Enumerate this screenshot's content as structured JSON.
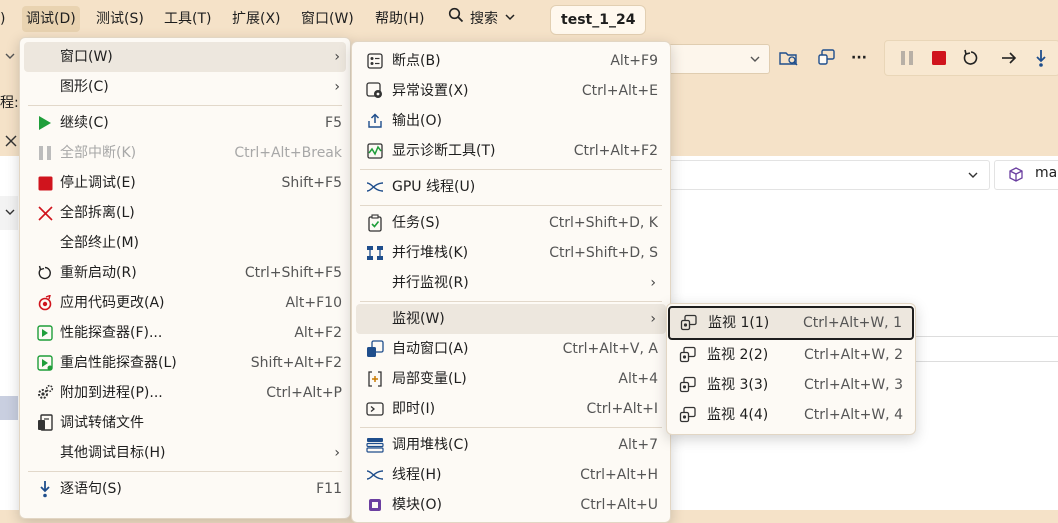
{
  "menubar": {
    "items": [
      "调试(D)",
      "测试(S)",
      "工具(T)",
      "扩展(X)",
      "窗口(W)",
      "帮助(H)"
    ],
    "search_label": "搜索",
    "doc_tab_title": "test_1_24"
  },
  "background": {
    "left_label_1": "程:",
    "nav_right_text": "ma"
  },
  "debug_menu": {
    "items": [
      {
        "label": "窗口(W)",
        "shortcut": ""
      },
      {
        "label": "图形(C)",
        "shortcut": ""
      },
      {
        "label": "继续(C)",
        "shortcut": "F5"
      },
      {
        "label": "全部中断(K)",
        "shortcut": "Ctrl+Alt+Break"
      },
      {
        "label": "停止调试(E)",
        "shortcut": "Shift+F5"
      },
      {
        "label": "全部拆离(L)",
        "shortcut": ""
      },
      {
        "label": "全部终止(M)",
        "shortcut": ""
      },
      {
        "label": "重新启动(R)",
        "shortcut": "Ctrl+Shift+F5"
      },
      {
        "label": "应用代码更改(A)",
        "shortcut": "Alt+F10"
      },
      {
        "label": "性能探查器(F)...",
        "shortcut": "Alt+F2"
      },
      {
        "label": "重启性能探查器(L)",
        "shortcut": "Shift+Alt+F2"
      },
      {
        "label": "附加到进程(P)...",
        "shortcut": "Ctrl+Alt+P"
      },
      {
        "label": "调试转储文件",
        "shortcut": ""
      },
      {
        "label": "其他调试目标(H)",
        "shortcut": ""
      },
      {
        "label": "逐语句(S)",
        "shortcut": "F11"
      }
    ]
  },
  "window_menu": {
    "items": [
      {
        "label": "断点(B)",
        "shortcut": "Alt+F9"
      },
      {
        "label": "异常设置(X)",
        "shortcut": "Ctrl+Alt+E"
      },
      {
        "label": "输出(O)",
        "shortcut": ""
      },
      {
        "label": "显示诊断工具(T)",
        "shortcut": "Ctrl+Alt+F2"
      },
      {
        "label": "GPU 线程(U)",
        "shortcut": ""
      },
      {
        "label": "任务(S)",
        "shortcut": "Ctrl+Shift+D, K"
      },
      {
        "label": "并行堆栈(K)",
        "shortcut": "Ctrl+Shift+D, S"
      },
      {
        "label": "并行监视(R)",
        "shortcut": ""
      },
      {
        "label": "监视(W)",
        "shortcut": ""
      },
      {
        "label": "自动窗口(A)",
        "shortcut": "Ctrl+Alt+V, A"
      },
      {
        "label": "局部变量(L)",
        "shortcut": "Alt+4"
      },
      {
        "label": "即时(I)",
        "shortcut": "Ctrl+Alt+I"
      },
      {
        "label": "调用堆栈(C)",
        "shortcut": "Alt+7"
      },
      {
        "label": "线程(H)",
        "shortcut": "Ctrl+Alt+H"
      },
      {
        "label": "模块(O)",
        "shortcut": "Ctrl+Alt+U"
      }
    ]
  },
  "watch_menu": {
    "items": [
      {
        "label": "监视 1(1)",
        "shortcut": "Ctrl+Alt+W, 1"
      },
      {
        "label": "监视 2(2)",
        "shortcut": "Ctrl+Alt+W, 2"
      },
      {
        "label": "监视 3(3)",
        "shortcut": "Ctrl+Alt+W, 3"
      },
      {
        "label": "监视 4(4)",
        "shortcut": "Ctrl+Alt+W, 4"
      }
    ]
  },
  "colors": {
    "theme_bg": "#f5e2c8",
    "menu_bg": "#fdfaf5",
    "highlight": "#ede7de",
    "stop_red": "#d0141d",
    "continue_green": "#1f9e3a",
    "icon_blue": "#1f4e8c"
  }
}
